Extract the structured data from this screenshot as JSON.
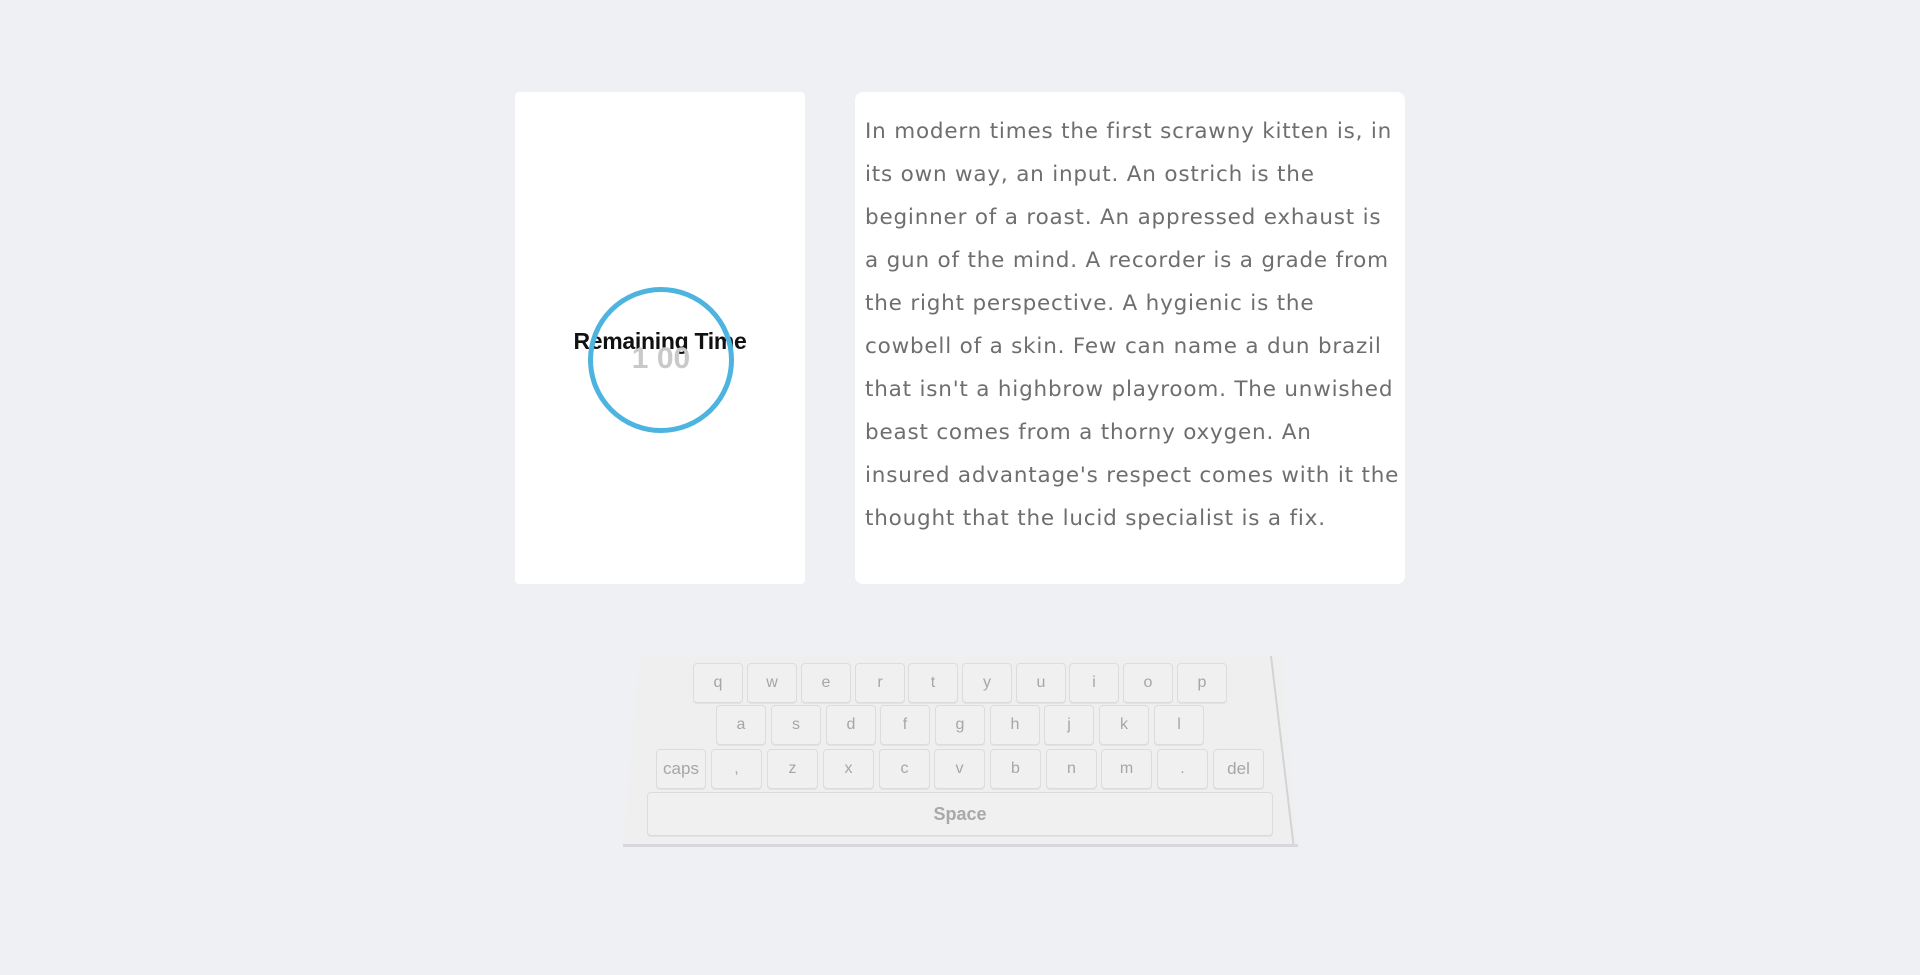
{
  "timer": {
    "title": "Remaining Time",
    "value": "1 00",
    "ring_color": "#4db3df"
  },
  "passage": {
    "text": "In modern times the first scrawny kitten is, in its own way, an input. An ostrich is the beginner of a roast. An appressed exhaust is a gun of the mind. A recorder is a grade from the right perspective. A hygienic is the cowbell of a skin. Few can name a dun brazil that isn't a highbrow playroom. The unwished beast comes from a thorny oxygen. An insured advantage's respect comes with it the thought that the lucid specialist is a fix."
  },
  "keyboard": {
    "row1": [
      "q",
      "w",
      "e",
      "r",
      "t",
      "y",
      "u",
      "i",
      "o",
      "p"
    ],
    "row2": [
      "a",
      "s",
      "d",
      "f",
      "g",
      "h",
      "j",
      "k",
      "l"
    ],
    "row3": [
      "caps",
      ",",
      "z",
      "x",
      "c",
      "v",
      "b",
      "n",
      "m",
      ".",
      "del"
    ],
    "space": "Space"
  }
}
